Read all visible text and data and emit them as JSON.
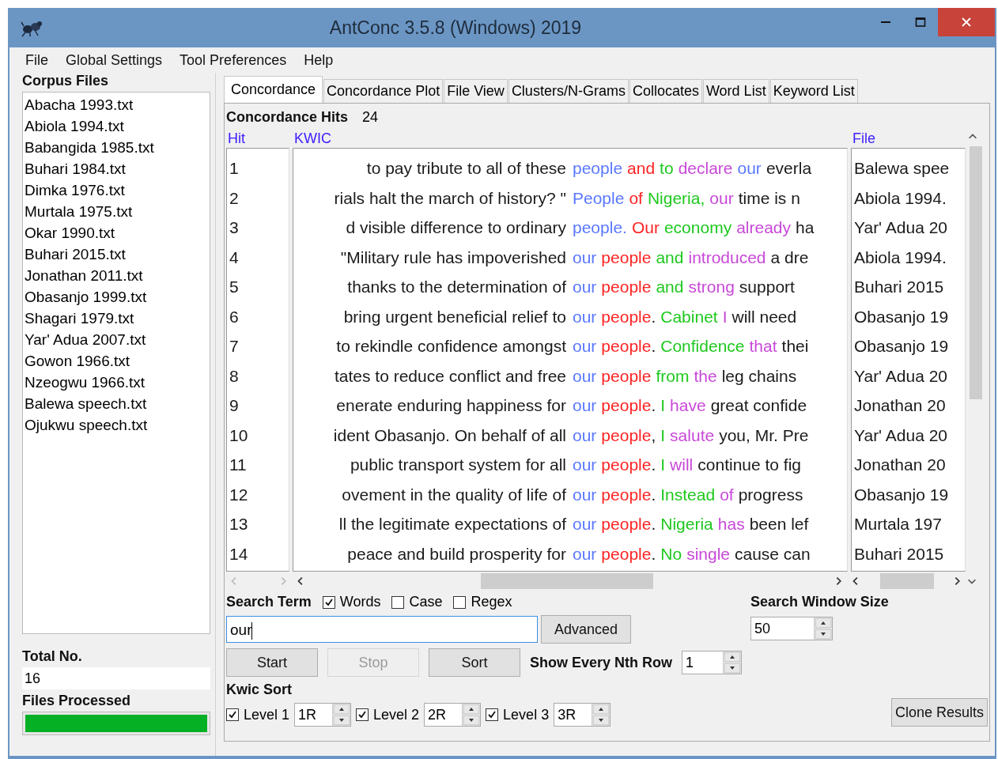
{
  "window": {
    "title": "AntConc 3.5.8 (Windows) 2019"
  },
  "menu": [
    "File",
    "Global Settings",
    "Tool Preferences",
    "Help"
  ],
  "corpus_files": {
    "heading": "Corpus Files",
    "items": [
      "Abacha 1993.txt",
      "Abiola 1994.txt",
      "Babangida 1985.txt",
      "Buhari 1984.txt",
      "Dimka 1976.txt",
      "Murtala 1975.txt",
      "Okar 1990.txt",
      "Buhari 2015.txt",
      "Jonathan 2011.txt",
      "Obasanjo 1999.txt",
      "Shagari 1979.txt",
      "Yar' Adua 2007.txt",
      "Gowon 1966.txt",
      "Nzeogwu 1966.txt",
      "Balewa speech.txt",
      "Ojukwu speech.txt"
    ]
  },
  "total": {
    "label": "Total No.",
    "value": "16"
  },
  "files_processed": {
    "label": "Files Processed",
    "level": 1
  },
  "tabs": [
    {
      "label": "Concordance",
      "selected": true
    },
    {
      "label": "Concordance Plot",
      "selected": false
    },
    {
      "label": "File View",
      "selected": false
    },
    {
      "label": "Clusters/N-Grams",
      "selected": false
    },
    {
      "label": "Collocates",
      "selected": false
    },
    {
      "label": "Word List",
      "selected": false
    },
    {
      "label": "Keyword List",
      "selected": false
    }
  ],
  "hits": {
    "label": "Concordance Hits",
    "value": "24"
  },
  "table": {
    "columns": [
      "Hit",
      "KWIC",
      "File"
    ],
    "rows": [
      {
        "hit": "1",
        "left": "to pay tribute to all of these",
        "tokens": [
          {
            "text": "people",
            "kind": "hit"
          },
          {
            "text": "and",
            "kind": "first"
          },
          {
            "text": "to",
            "kind": "second"
          },
          {
            "text": "declare",
            "kind": "third"
          },
          {
            "text": "our",
            "kind": "hit"
          },
          {
            "text": "everla",
            "kind": "plain"
          }
        ],
        "file": "Balewa spee"
      },
      {
        "hit": "2",
        "left": "rials halt the march of history? \"",
        "tokens": [
          {
            "text": "People",
            "kind": "hit"
          },
          {
            "text": "of",
            "kind": "first"
          },
          {
            "text": "Nigeria,",
            "kind": "second"
          },
          {
            "text": "our",
            "kind": "third"
          },
          {
            "text": "time is n",
            "kind": "plain"
          }
        ],
        "file": "Abiola 1994."
      },
      {
        "hit": "3",
        "left": "d visible difference to ordinary",
        "tokens": [
          {
            "text": "people.",
            "kind": "hit"
          },
          {
            "text": "Our",
            "kind": "first"
          },
          {
            "text": "economy",
            "kind": "second"
          },
          {
            "text": "already",
            "kind": "third"
          },
          {
            "text": "ha",
            "kind": "plain"
          }
        ],
        "file": "Yar' Adua 20"
      },
      {
        "hit": "4",
        "left": "\"Military rule has impoverished",
        "tokens": [
          {
            "text": "our",
            "kind": "hit"
          },
          {
            "text": "people",
            "kind": "first"
          },
          {
            "text": "and",
            "kind": "second"
          },
          {
            "text": "introduced",
            "kind": "third"
          },
          {
            "text": "a dre",
            "kind": "plain"
          }
        ],
        "file": "Abiola 1994."
      },
      {
        "hit": "5",
        "left": "thanks to the determination of",
        "tokens": [
          {
            "text": "our",
            "kind": "hit"
          },
          {
            "text": "people",
            "kind": "first"
          },
          {
            "text": "and",
            "kind": "second"
          },
          {
            "text": "strong",
            "kind": "third"
          },
          {
            "text": "support",
            "kind": "plain"
          }
        ],
        "file": "Buhari 2015"
      },
      {
        "hit": "6",
        "left": "bring urgent beneficial relief to",
        "tokens": [
          {
            "text": "our",
            "kind": "hit"
          },
          {
            "text": "people",
            "kind": "first"
          },
          {
            "text": ".",
            "kind": "punct"
          },
          {
            "text": "Cabinet",
            "kind": "second"
          },
          {
            "text": "I",
            "kind": "third"
          },
          {
            "text": "will need",
            "kind": "plain"
          }
        ],
        "file": "Obasanjo 19"
      },
      {
        "hit": "7",
        "left": "to rekindle confidence amongst",
        "tokens": [
          {
            "text": "our",
            "kind": "hit"
          },
          {
            "text": "people",
            "kind": "first"
          },
          {
            "text": ".",
            "kind": "punct"
          },
          {
            "text": "Confidence",
            "kind": "second"
          },
          {
            "text": "that",
            "kind": "third"
          },
          {
            "text": "thei",
            "kind": "plain"
          }
        ],
        "file": "Obasanjo 19"
      },
      {
        "hit": "8",
        "left": "tates to reduce conflict and free",
        "tokens": [
          {
            "text": "our",
            "kind": "hit"
          },
          {
            "text": "people",
            "kind": "first"
          },
          {
            "text": "from",
            "kind": "second"
          },
          {
            "text": "the",
            "kind": "third"
          },
          {
            "text": "leg chains",
            "kind": "plain"
          }
        ],
        "file": "Yar' Adua 20"
      },
      {
        "hit": "9",
        "left": "enerate enduring happiness for",
        "tokens": [
          {
            "text": "our",
            "kind": "hit"
          },
          {
            "text": "people",
            "kind": "first"
          },
          {
            "text": ".",
            "kind": "punct"
          },
          {
            "text": "I",
            "kind": "second"
          },
          {
            "text": "have",
            "kind": "third"
          },
          {
            "text": "great confide",
            "kind": "plain"
          }
        ],
        "file": "Jonathan 20"
      },
      {
        "hit": "10",
        "left": "ident Obasanjo. On behalf of all",
        "tokens": [
          {
            "text": "our",
            "kind": "hit"
          },
          {
            "text": "people",
            "kind": "first"
          },
          {
            "text": ",",
            "kind": "punct"
          },
          {
            "text": "I",
            "kind": "second"
          },
          {
            "text": "salute",
            "kind": "third"
          },
          {
            "text": "you, Mr. Pre",
            "kind": "plain"
          }
        ],
        "file": "Yar' Adua 20"
      },
      {
        "hit": "11",
        "left": "public transport system for all",
        "tokens": [
          {
            "text": "our",
            "kind": "hit"
          },
          {
            "text": "people",
            "kind": "first"
          },
          {
            "text": ".",
            "kind": "punct"
          },
          {
            "text": "I",
            "kind": "second"
          },
          {
            "text": "will",
            "kind": "third"
          },
          {
            "text": "continue to fig",
            "kind": "plain"
          }
        ],
        "file": "Jonathan 20"
      },
      {
        "hit": "12",
        "left": "ovement in the quality of life of",
        "tokens": [
          {
            "text": "our",
            "kind": "hit"
          },
          {
            "text": "people",
            "kind": "first"
          },
          {
            "text": ".",
            "kind": "punct"
          },
          {
            "text": "Instead",
            "kind": "second"
          },
          {
            "text": "of",
            "kind": "third"
          },
          {
            "text": "progress",
            "kind": "plain"
          }
        ],
        "file": "Obasanjo 19"
      },
      {
        "hit": "13",
        "left": "ll the legitimate expectations of",
        "tokens": [
          {
            "text": "our",
            "kind": "hit"
          },
          {
            "text": "people",
            "kind": "first"
          },
          {
            "text": ".",
            "kind": "punct"
          },
          {
            "text": "Nigeria",
            "kind": "second"
          },
          {
            "text": "has",
            "kind": "third"
          },
          {
            "text": "been lef",
            "kind": "plain"
          }
        ],
        "file": "Murtala 197"
      },
      {
        "hit": "14",
        "left": "peace and build prosperity for",
        "tokens": [
          {
            "text": "our",
            "kind": "hit"
          },
          {
            "text": "people",
            "kind": "first"
          },
          {
            "text": ".",
            "kind": "punct"
          },
          {
            "text": "No",
            "kind": "second"
          },
          {
            "text": "single",
            "kind": "third"
          },
          {
            "text": "cause can",
            "kind": "plain"
          }
        ],
        "file": "Buhari 2015"
      }
    ]
  },
  "search": {
    "label": "Search Term",
    "options": [
      {
        "label": "Words",
        "checked": true
      },
      {
        "label": "Case",
        "checked": false
      },
      {
        "label": "Regex",
        "checked": false
      }
    ],
    "value": "our",
    "advanced": "Advanced"
  },
  "buttons": [
    {
      "label": "Start",
      "disabled": false
    },
    {
      "label": "Stop",
      "disabled": true
    },
    {
      "label": "Sort",
      "disabled": false
    }
  ],
  "nth_row": {
    "label": "Show Every Nth Row",
    "value": "1"
  },
  "window_size": {
    "label": "Search Window Size",
    "value": "50"
  },
  "kwic_sort": {
    "label": "Kwic Sort",
    "levels": [
      {
        "label": "Level 1",
        "checked": true,
        "value": "1R"
      },
      {
        "label": "Level 2",
        "checked": true,
        "value": "2R"
      },
      {
        "label": "Level 3",
        "checked": true,
        "value": "3R"
      }
    ]
  },
  "clone": "Clone Results"
}
